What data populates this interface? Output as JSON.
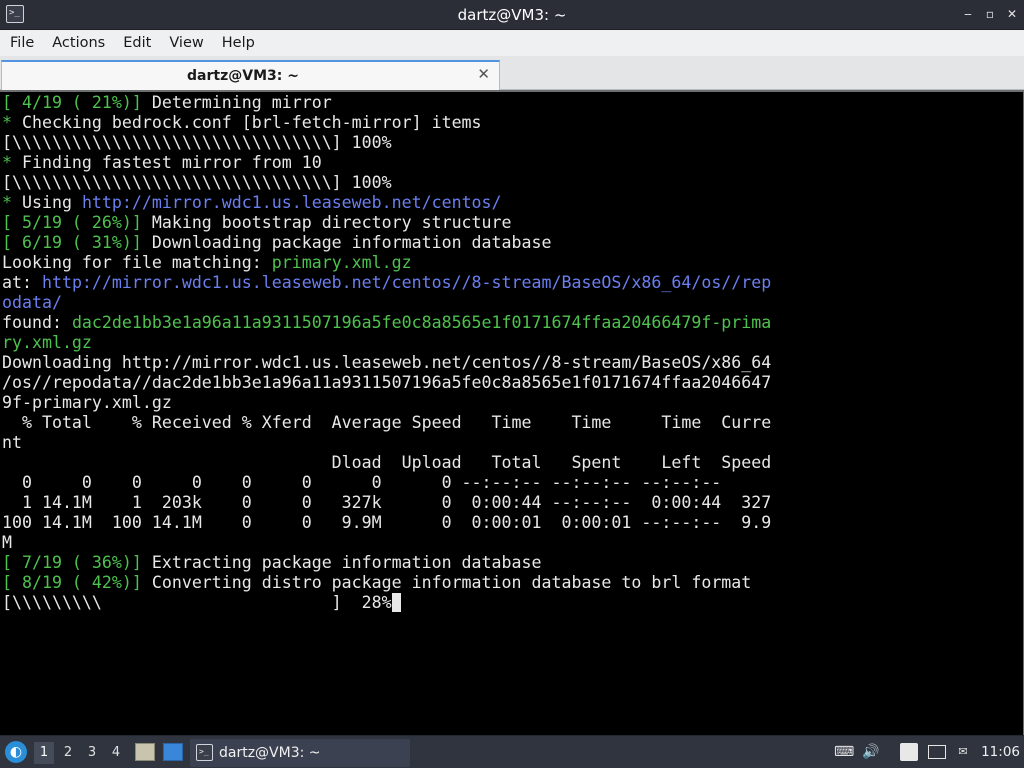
{
  "window": {
    "title": "dartz@VM3: ~",
    "app_icon_glyph": ">_",
    "controls": {
      "minimize": "‒",
      "maximize": "▫",
      "close": "✕"
    }
  },
  "menu": {
    "items": [
      "File",
      "Actions",
      "Edit",
      "View",
      "Help"
    ]
  },
  "tabs": [
    {
      "label": "dartz@VM3: ~",
      "close": "✕",
      "active": true
    }
  ],
  "terminal": {
    "colors": {
      "background": "#000000",
      "text": "#e8e8e8",
      "green": "#4ec24e",
      "blue": "#6b7ff0"
    },
    "lines": [
      [
        {
          "t": "[ 4/19 ( 21%)] ",
          "c": "g"
        },
        {
          "t": "Determining mirror",
          "c": ""
        }
      ],
      [
        {
          "t": "* ",
          "c": "g"
        },
        {
          "t": "Checking bedrock.conf [brl-fetch-mirror] items",
          "c": ""
        }
      ],
      [
        {
          "t": "[\\\\\\\\\\\\\\\\\\\\\\\\\\\\\\\\\\\\\\\\\\\\\\\\\\\\\\\\\\\\\\\\] 100%",
          "c": ""
        }
      ],
      [
        {
          "t": "* ",
          "c": "g"
        },
        {
          "t": "Finding fastest mirror from 10",
          "c": ""
        }
      ],
      [
        {
          "t": "[\\\\\\\\\\\\\\\\\\\\\\\\\\\\\\\\\\\\\\\\\\\\\\\\\\\\\\\\\\\\\\\\] 100%",
          "c": ""
        }
      ],
      [
        {
          "t": "* ",
          "c": "g"
        },
        {
          "t": "Using ",
          "c": ""
        },
        {
          "t": "http://mirror.wdc1.us.leaseweb.net/centos/",
          "c": "b"
        }
      ],
      [
        {
          "t": "[ 5/19 ( 26%)] ",
          "c": "g"
        },
        {
          "t": "Making bootstrap directory structure",
          "c": ""
        }
      ],
      [
        {
          "t": "[ 6/19 ( 31%)] ",
          "c": "g"
        },
        {
          "t": "Downloading package information database",
          "c": ""
        }
      ],
      [
        {
          "t": "Looking for file matching: ",
          "c": ""
        },
        {
          "t": "primary.xml.gz",
          "c": "g"
        }
      ],
      [
        {
          "t": "at: ",
          "c": ""
        },
        {
          "t": "http://mirror.wdc1.us.leaseweb.net/centos//8-stream/BaseOS/x86_64/os//rep",
          "c": "b"
        }
      ],
      [
        {
          "t": "odata/",
          "c": "b"
        }
      ],
      [
        {
          "t": "found: ",
          "c": ""
        },
        {
          "t": "dac2de1bb3e1a96a11a9311507196a5fe0c8a8565e1f0171674ffaa20466479f-prima",
          "c": "g"
        }
      ],
      [
        {
          "t": "ry.xml.gz",
          "c": "g"
        }
      ],
      [
        {
          "t": "Downloading http://mirror.wdc1.us.leaseweb.net/centos//8-stream/BaseOS/x86_64",
          "c": ""
        }
      ],
      [
        {
          "t": "/os//repodata//dac2de1bb3e1a96a11a9311507196a5fe0c8a8565e1f0171674ffaa2046647",
          "c": ""
        }
      ],
      [
        {
          "t": "9f-primary.xml.gz",
          "c": ""
        }
      ],
      [
        {
          "t": "  % Total    % Received % Xferd  Average Speed   Time    Time     Time  Curre",
          "c": ""
        }
      ],
      [
        {
          "t": "nt",
          "c": ""
        }
      ],
      [
        {
          "t": "                                 Dload  Upload   Total   Spent    Left  Speed",
          "c": ""
        }
      ],
      [
        {
          "t": "  0     0    0     0    0     0      0      0 --:--:-- --:--:-- --:--:--",
          "c": ""
        }
      ],
      [
        {
          "t": "  1 14.1M    1  203k    0     0   327k      0  0:00:44 --:--:--  0:00:44  327",
          "c": ""
        }
      ],
      [
        {
          "t": "100 14.1M  100 14.1M    0     0   9.9M      0  0:00:01  0:00:01 --:--:--  9.9",
          "c": ""
        }
      ],
      [
        {
          "t": "M",
          "c": ""
        }
      ],
      [
        {
          "t": "[ 7/19 ( 36%)] ",
          "c": "g"
        },
        {
          "t": "Extracting package information database",
          "c": ""
        }
      ],
      [
        {
          "t": "[ 8/19 ( 42%)] ",
          "c": "g"
        },
        {
          "t": "Converting distro package information database to brl format",
          "c": ""
        }
      ],
      [
        {
          "t": "[\\\\\\\\\\\\\\\\\\                       ]  28%",
          "c": ""
        }
      ]
    ]
  },
  "taskbar": {
    "logo_glyph": "◐",
    "workspaces": [
      {
        "label": "1",
        "active": true
      },
      {
        "label": "2",
        "active": false
      },
      {
        "label": "3",
        "active": false
      },
      {
        "label": "4",
        "active": false
      }
    ],
    "launchers": [
      "file-manager-icon",
      "show-desktop-icon"
    ],
    "task": {
      "label": "dartz@VM3: ~",
      "icon_glyph": ">_"
    },
    "tray_icons": [
      "keyboard-icon",
      "volume-icon",
      "clipboard-icon",
      "network-icon"
    ],
    "clock": "11:06"
  }
}
